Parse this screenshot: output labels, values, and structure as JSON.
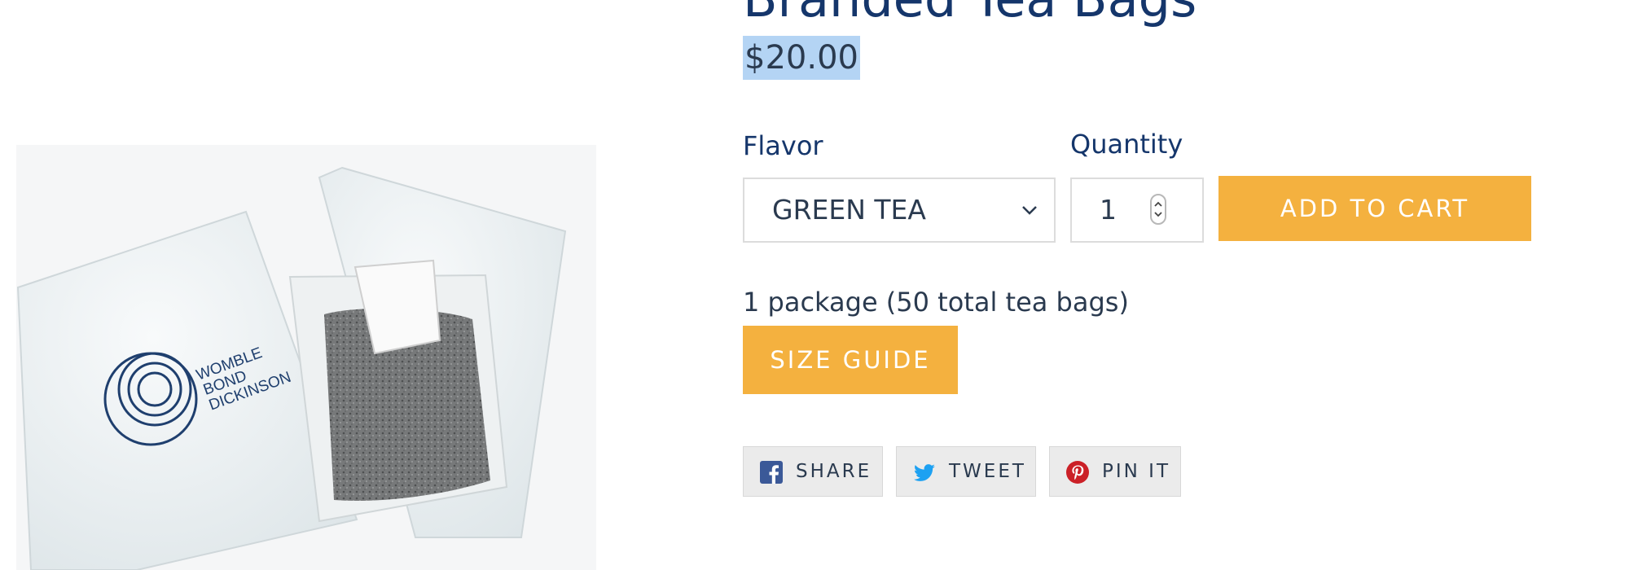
{
  "product": {
    "title": "Branded Tea Bags",
    "price": "$20.00",
    "image_alt": "Tea bags in white sachets printed with Womble Bond Dickinson logo",
    "image_brand_text": [
      "WOMBLE",
      "BOND",
      "DICKINSON"
    ]
  },
  "form": {
    "flavor_label": "Flavor",
    "flavor_value": "GREEN TEA",
    "quantity_label": "Quantity",
    "quantity_value": "1",
    "add_to_cart_label": "ADD TO CART"
  },
  "description": {
    "package_text": "1 package (50 total tea bags)",
    "size_guide_label": "SIZE GUIDE"
  },
  "share": [
    {
      "label": "SHARE",
      "icon": "facebook-icon",
      "color": "#3b5998"
    },
    {
      "label": "TWEET",
      "icon": "twitter-icon",
      "color": "#1da1f2"
    },
    {
      "label": "PIN IT",
      "icon": "pinterest-icon",
      "color": "#cb2027"
    }
  ],
  "colors": {
    "heading": "#15366b",
    "accent_button": "#f4b13f",
    "selection_highlight": "#b4d4f4"
  }
}
